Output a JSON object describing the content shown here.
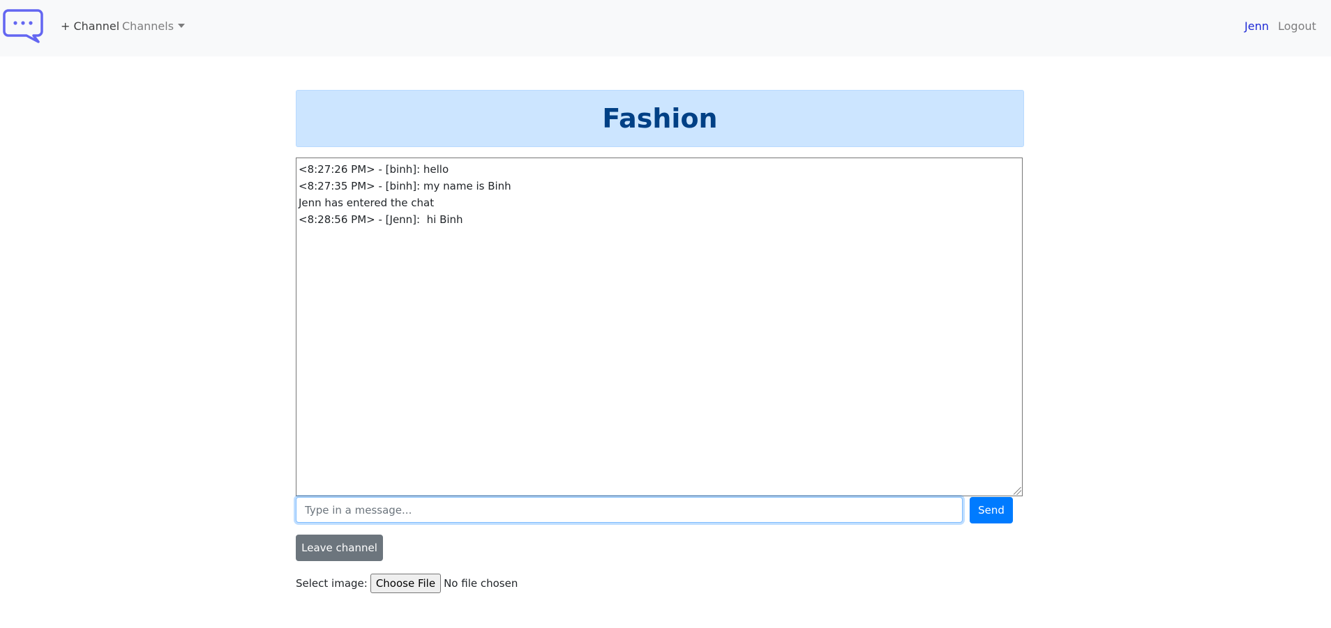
{
  "navbar": {
    "logo_icon": "chat-bubble-icon",
    "add_channel_label": "+ Channel",
    "channels_label": "Channels",
    "user_name": "Jenn",
    "logout_label": "Logout"
  },
  "channel": {
    "title": "Fashion"
  },
  "chat": {
    "lines": [
      "<8:27:26 PM> - [binh]: hello",
      "<8:27:35 PM> - [binh]: my name is Binh",
      "Jenn has entered the chat",
      "<8:28:56 PM> - [Jenn]:  hi Binh"
    ]
  },
  "composer": {
    "placeholder": "Type in a message...",
    "value": "",
    "send_label": "Send"
  },
  "actions": {
    "leave_label": "Leave channel"
  },
  "upload": {
    "label": "Select image:",
    "button_label": "Choose File",
    "status": "No file chosen"
  },
  "colors": {
    "brand_icon": "#6366f1",
    "primary": "#007bff",
    "secondary": "#6c757d",
    "header_bg": "#cce5ff",
    "header_text": "#004085"
  }
}
